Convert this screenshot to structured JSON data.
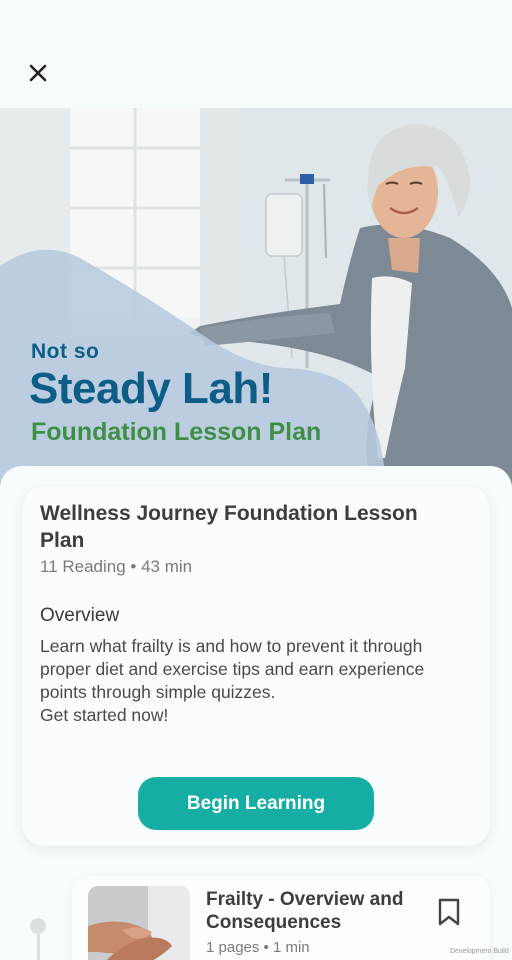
{
  "header": {
    "close_icon": "close-icon"
  },
  "hero": {
    "kicker": "Not so",
    "title": "Steady Lah!",
    "subtitle": "Foundation Lesson Plan"
  },
  "lesson_plan": {
    "title": "Wellness Journey Foundation Lesson Plan",
    "meta": "11 Reading • 43 min",
    "overview_heading": "Overview",
    "overview_text": "Learn what frailty is and how to prevent it through proper diet and exercise tips and earn experience points through simple quizzes.\nGet started now!",
    "begin_label": "Begin Learning"
  },
  "lessons": [
    {
      "title": "Frailty - Overview and Consequences",
      "meta": "1 pages • 1 min",
      "bookmark_icon": "bookmark-icon"
    }
  ],
  "watermark": "Development Build",
  "colors": {
    "brand_blue": "#0d5e86",
    "brand_green": "#3f8e45",
    "accent_teal": "#16ada4"
  }
}
